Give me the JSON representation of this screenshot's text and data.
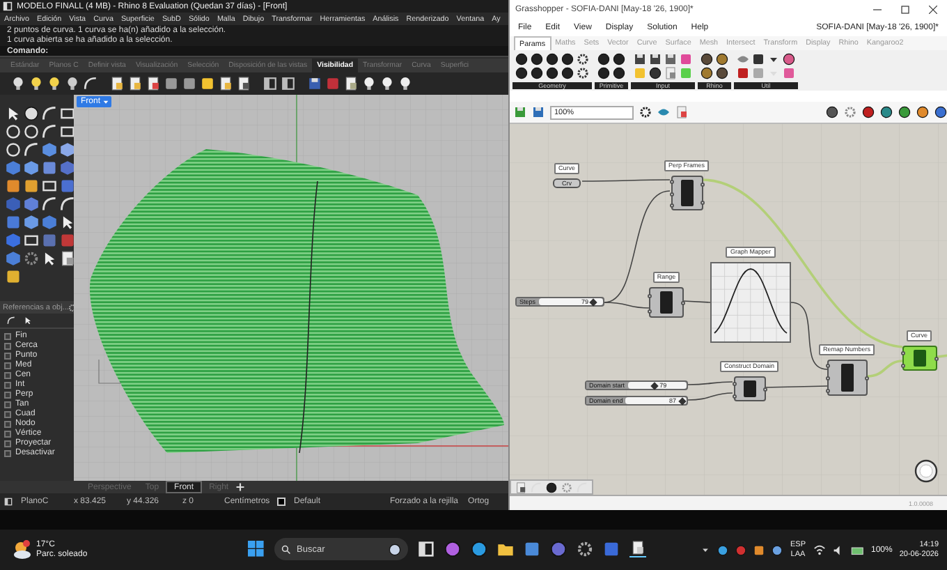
{
  "rhino": {
    "title": "MODELO FINALL (4 MB) - Rhino 8 Evaluation (Quedan 37 días) - [Front]",
    "menu": [
      "Archivo",
      "Edición",
      "Vista",
      "Curva",
      "Superficie",
      "SubD",
      "Sólido",
      "Malla",
      "Dibujo",
      "Transformar",
      "Herramientas",
      "Análisis",
      "Renderizado",
      "Ventana",
      "Ay"
    ],
    "history": [
      "2 puntos de curva. 1 curva se ha(n) añadido a la selección.",
      "1 curva abierta se ha añadido a la selección."
    ],
    "command_prompt": "Comando:",
    "toolbar_tabs": [
      {
        "label": "Estándar",
        "selected": false
      },
      {
        "label": "Planos C",
        "selected": false
      },
      {
        "label": "Definir vista",
        "selected": false
      },
      {
        "label": "Visualización",
        "selected": false
      },
      {
        "label": "Selección",
        "selected": false
      },
      {
        "label": "Disposición de las vistas",
        "selected": false
      },
      {
        "label": "Visibilidad",
        "selected": true
      },
      {
        "label": "Transformar",
        "selected": false
      },
      {
        "label": "Curva",
        "selected": false
      },
      {
        "label": "Superfici",
        "selected": false
      }
    ],
    "viewport": {
      "label": "Front"
    },
    "osnap": {
      "title": "Referencias a obj...",
      "items": [
        {
          "label": "Fin",
          "checked": false
        },
        {
          "label": "Cerca",
          "checked": false
        },
        {
          "label": "Punto",
          "checked": false
        },
        {
          "label": "Med",
          "checked": false
        },
        {
          "label": "Cen",
          "checked": false
        },
        {
          "label": "Int",
          "checked": false
        },
        {
          "label": "Perp",
          "checked": false
        },
        {
          "label": "Tan",
          "checked": false
        },
        {
          "label": "Cuad",
          "checked": false
        },
        {
          "label": "Nodo",
          "checked": false
        },
        {
          "label": "Vértice",
          "checked": false
        },
        {
          "label": "Proyectar",
          "checked": false
        },
        {
          "label": "Desactivar",
          "checked": false
        }
      ]
    },
    "viewport_tabs": [
      {
        "label": "Perspective",
        "selected": false
      },
      {
        "label": "Top",
        "selected": false
      },
      {
        "label": "Front",
        "selected": true
      },
      {
        "label": "Right",
        "selected": false
      }
    ],
    "status": {
      "plane": "PlanoC",
      "x": "x 83.425",
      "y": "y 44.326",
      "z": "z 0",
      "units": "Centímetros",
      "layer": "Default",
      "snap": "Forzado a la rejilla",
      "ortho": "Ortog"
    }
  },
  "grasshopper": {
    "title": "Grasshopper - SOFIA-DANI [May-18 '26, 1900]*",
    "menu": [
      "File",
      "Edit",
      "View",
      "Display",
      "Solution",
      "Help"
    ],
    "document": "SOFIA-DANI [May-18 '26, 1900]*",
    "tabs": [
      {
        "label": "Params",
        "selected": true
      },
      {
        "label": "Maths",
        "selected": false
      },
      {
        "label": "Sets",
        "selected": false
      },
      {
        "label": "Vector",
        "selected": false
      },
      {
        "label": "Curve",
        "selected": false
      },
      {
        "label": "Surface",
        "selected": false
      },
      {
        "label": "Mesh",
        "selected": false
      },
      {
        "label": "Intersect",
        "selected": false
      },
      {
        "label": "Transform",
        "selected": false
      },
      {
        "label": "Display",
        "selected": false
      },
      {
        "label": "Rhino",
        "selected": false
      },
      {
        "label": "Kangaroo2",
        "selected": false
      }
    ],
    "groups": [
      "Geometry",
      "Primitive",
      "Input",
      "Rhino",
      "Util"
    ],
    "zoom": "100%",
    "nodes": [
      {
        "kind": "param",
        "label": "Curve",
        "body": "Crv"
      },
      {
        "kind": "component",
        "label": "Perp Frames",
        "selected": false
      },
      {
        "kind": "slider",
        "label": "Steps",
        "value": "79",
        "level": 0.86
      },
      {
        "kind": "component",
        "label": "Range",
        "selected": false
      },
      {
        "kind": "graph",
        "label": "Graph Mapper"
      },
      {
        "kind": "component",
        "label": "Remap Numbers",
        "selected": false
      },
      {
        "kind": "component",
        "label": "Construct Domain",
        "selected": false
      },
      {
        "kind": "slider",
        "label": "Domain start",
        "value": "79",
        "level": 0.45
      },
      {
        "kind": "slider",
        "label": "Domain end",
        "value": "87",
        "level": 0.92
      },
      {
        "kind": "component",
        "label": "Curve",
        "selected": true
      }
    ],
    "version": "1.0.0008"
  },
  "taskbar": {
    "temperature": "17°C",
    "weather": "Parc. soleado",
    "search": "Buscar",
    "language": "ESP",
    "layout": "LAA",
    "battery": "100%",
    "time": "14:19",
    "date": "20-06-2026"
  }
}
